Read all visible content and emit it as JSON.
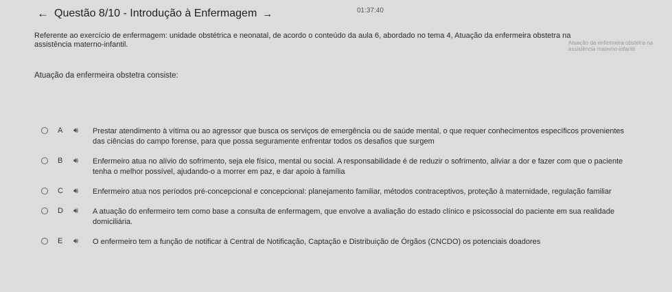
{
  "header": {
    "back_icon": "arrow-left-icon",
    "title": "Questão 8/10 - Introdução à Enfermagem",
    "forward_icon": "arrow-right-icon",
    "timer": "01:37:40"
  },
  "question": {
    "context_text": "Referente ao exercício de enfermagem: unidade obstétrica e neonatal, de acordo o conteúdo da aula 6, abordado no tema 4, Atuação da enfermeira obstetra na ",
    "context_blur": "assistência materno-infantil.",
    "context_tail": "Atuação da enfermeira obstetra na assistência materno-infantil",
    "prompt": "Atuação da enfermeira obstetra consiste:"
  },
  "options": [
    {
      "letter": "A",
      "speaker_icon": "speaker-icon",
      "text": "Prestar atendimento à vítima ou ao agressor que busca os serviços de emergência ou de saúde mental, o que requer conhecimentos específicos provenientes das ciências do campo forense, para que possa seguramente enfrentar todos os desafios que surgem",
      "faded": ""
    },
    {
      "letter": "B",
      "speaker_icon": "speaker-icon",
      "text": "Enfermeiro atua no alívio do sofrimento, seja ele físico, mental ou social. A responsabilidade é de reduzir o sofrimento, aliviar a dor e fazer com que o paciente tenha o melhor possível, ajudando-o a morrer em paz, e dar apoio à família",
      "faded": ""
    },
    {
      "letter": "C",
      "speaker_icon": "speaker-icon",
      "text": "Enfermeiro atua nos períodos pré-concepcional e concepcional: planejamento familiar, métodos contraceptivos, proteção à maternidade, regulação familiar",
      "faded": ""
    },
    {
      "letter": "D",
      "speaker_icon": "speaker-icon",
      "text": "A atuação do enfermeiro tem como base a consulta de enfermagem, que envolve a avaliação do estado clínico e psicossocial do paciente em sua realidade domiciliária.",
      "faded": ""
    },
    {
      "letter": "E",
      "speaker_icon": "speaker-icon",
      "text": "O enfermeiro tem a função de notificar à Central de Notificação, Captação e Distribuição de Órgãos (CNCDO) os potenciais doadores",
      "faded": ""
    }
  ]
}
